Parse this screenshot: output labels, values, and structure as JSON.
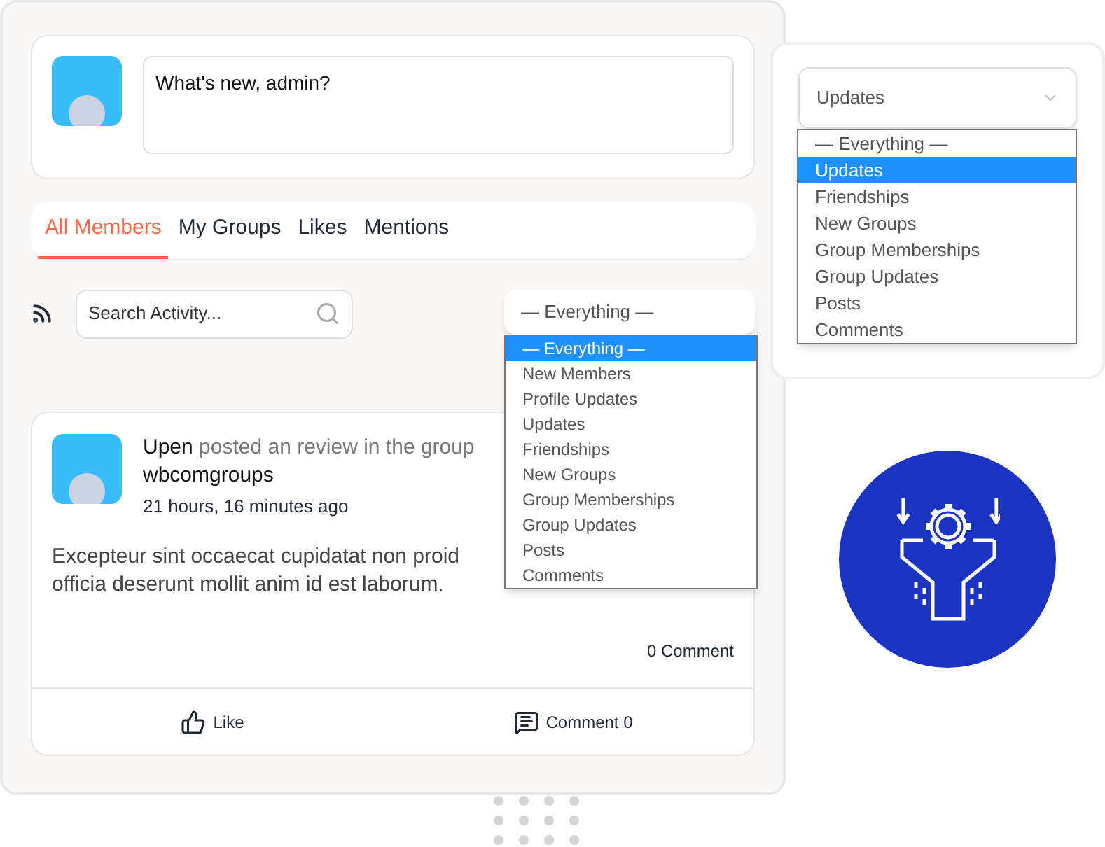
{
  "composer": {
    "placeholder": "What's new, admin?"
  },
  "tabs": [
    {
      "label": "All Members",
      "selected": true
    },
    {
      "label": "My Groups",
      "selected": false
    },
    {
      "label": "Likes",
      "selected": false
    },
    {
      "label": "Mentions",
      "selected": false
    }
  ],
  "search": {
    "placeholder": "Search Activity..."
  },
  "activity_filter": {
    "value": "— Everything —",
    "options": [
      {
        "label": "— Everything —",
        "selected": true
      },
      {
        "label": "New Members",
        "selected": false
      },
      {
        "label": "Profile Updates",
        "selected": false
      },
      {
        "label": "Updates",
        "selected": false
      },
      {
        "label": "Friendships",
        "selected": false
      },
      {
        "label": "New Groups",
        "selected": false
      },
      {
        "label": "Group Memberships",
        "selected": false
      },
      {
        "label": "Group Updates",
        "selected": false
      },
      {
        "label": "Posts",
        "selected": false
      },
      {
        "label": "Comments",
        "selected": false
      }
    ]
  },
  "post": {
    "author": "Upen",
    "action": "posted an review in the group",
    "group": "wbcomgroups",
    "time": "21 hours, 16 minutes ago",
    "body_lines": [
      "Excepteur sint occaecat cupidatat non proid",
      "officia deserunt mollit anim id est laborum."
    ],
    "comment_count": "0 Comment",
    "actions": [
      {
        "kind": "like",
        "label": "Like"
      },
      {
        "kind": "comment",
        "label": "Comment 0"
      }
    ]
  },
  "side_filter": {
    "value": "Updates",
    "options": [
      {
        "label": "— Everything —",
        "selected": false
      },
      {
        "label": "Updates",
        "selected": true
      },
      {
        "label": "Friendships",
        "selected": false
      },
      {
        "label": "New Groups",
        "selected": false
      },
      {
        "label": "Group Memberships",
        "selected": false
      },
      {
        "label": "Group Updates",
        "selected": false
      },
      {
        "label": "Posts",
        "selected": false
      },
      {
        "label": "Comments",
        "selected": false
      }
    ]
  }
}
